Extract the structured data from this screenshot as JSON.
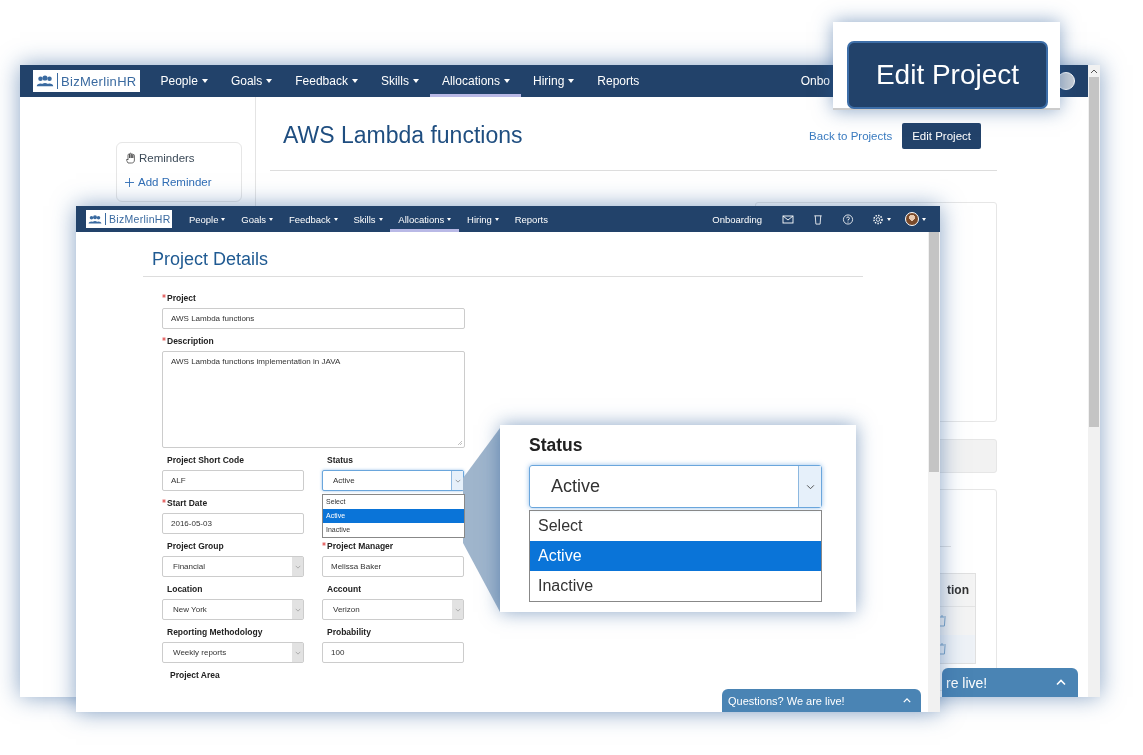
{
  "back_window": {
    "nav": {
      "logo": "BizMerlinHR",
      "items": [
        {
          "label": "People",
          "dropdown": true,
          "selected": false
        },
        {
          "label": "Goals",
          "dropdown": true,
          "selected": false
        },
        {
          "label": "Feedback",
          "dropdown": true,
          "selected": false
        },
        {
          "label": "Skills",
          "dropdown": true,
          "selected": false
        },
        {
          "label": "Allocations",
          "dropdown": true,
          "selected": true
        },
        {
          "label": "Hiring",
          "dropdown": true,
          "selected": false
        },
        {
          "label": "Reports",
          "dropdown": false,
          "selected": false
        }
      ],
      "right_item": "Onbo"
    },
    "reminders": {
      "title": "Reminders",
      "add": "Add Reminder"
    },
    "title": "AWS Lambda functions",
    "back_link": "Back to Projects",
    "edit_button": "Edit Project",
    "table_header": "tion",
    "chat": "re live!"
  },
  "front_window": {
    "nav": {
      "logo": "BizMerlinHR",
      "items": [
        {
          "label": "People",
          "dropdown": true,
          "selected": false
        },
        {
          "label": "Goals",
          "dropdown": true,
          "selected": false
        },
        {
          "label": "Feedback",
          "dropdown": true,
          "selected": false
        },
        {
          "label": "Skills",
          "dropdown": true,
          "selected": false
        },
        {
          "label": "Allocations",
          "dropdown": true,
          "selected": true
        },
        {
          "label": "Hiring",
          "dropdown": true,
          "selected": false
        },
        {
          "label": "Reports",
          "dropdown": false,
          "selected": false
        }
      ],
      "right_item": "Onboarding"
    },
    "heading": "Project Details",
    "rows": [
      [
        {
          "label": "Project",
          "required": true,
          "kind": "text",
          "value": "AWS Lambda functions",
          "wide": true
        }
      ],
      [
        {
          "label": "Description",
          "required": true,
          "kind": "textarea",
          "value": "AWS Lambda functions implementation in JAVA",
          "wide": true
        }
      ],
      [
        {
          "label": "Project Short Code",
          "required": false,
          "kind": "text",
          "value": "ALF",
          "wide": false
        },
        {
          "label": "Status",
          "required": false,
          "kind": "open_select",
          "value": "Active",
          "wide": false,
          "options": [
            {
              "label": "Select",
              "selected": false
            },
            {
              "label": "Active",
              "selected": true
            },
            {
              "label": "Inactive",
              "selected": false
            }
          ]
        }
      ],
      [
        {
          "label": "Start Date",
          "required": true,
          "kind": "text",
          "value": "2016-05-03",
          "wide": false
        }
      ],
      [
        {
          "label": "Project Group",
          "required": false,
          "kind": "select",
          "value": "Financial",
          "wide": false
        },
        {
          "label": "Project Manager",
          "required": true,
          "kind": "text",
          "value": "Melissa Baker",
          "wide": false
        }
      ],
      [
        {
          "label": "Location",
          "required": false,
          "kind": "select",
          "value": "New York",
          "wide": false
        },
        {
          "label": "Account",
          "required": false,
          "kind": "select",
          "value": "Verizon",
          "wide": false
        }
      ],
      [
        {
          "label": "Reporting Methodology",
          "required": false,
          "kind": "select",
          "value": "Weekly reports",
          "wide": false
        },
        {
          "label": "Probability",
          "required": false,
          "kind": "text",
          "value": "100",
          "wide": false
        }
      ],
      [
        {
          "label": "Project Area",
          "required": false,
          "kind": "label"
        }
      ]
    ],
    "chat": "Questions? We are live!"
  },
  "zoom_status": {
    "label": "Status",
    "value": "Active",
    "options": [
      {
        "label": "Select",
        "selected": false
      },
      {
        "label": "Active",
        "selected": true
      },
      {
        "label": "Inactive",
        "selected": false
      }
    ]
  },
  "zoom_edit": {
    "button": "Edit Project"
  }
}
